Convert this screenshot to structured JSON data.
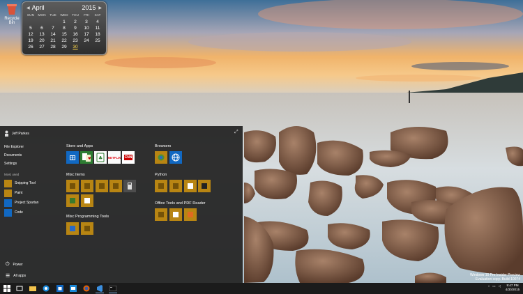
{
  "desktop": {
    "recycle_bin_label": "Recycle Bin",
    "watermark": {
      "line1": "Windows 10 Pro Insider Preview",
      "line2": "Evaluation copy. Build 10074"
    }
  },
  "calendar": {
    "month": "April",
    "year": "2015",
    "days_of_week": [
      "SUN",
      "MON",
      "TUE",
      "WED",
      "THU",
      "FRI",
      "SAT"
    ],
    "weeks": [
      [
        "",
        "",
        "",
        "1",
        "2",
        "3",
        "4"
      ],
      [
        "5",
        "6",
        "7",
        "8",
        "9",
        "10",
        "11"
      ],
      [
        "12",
        "13",
        "14",
        "15",
        "16",
        "17",
        "18"
      ],
      [
        "19",
        "20",
        "21",
        "22",
        "23",
        "24",
        "25"
      ],
      [
        "26",
        "27",
        "28",
        "29",
        "30",
        "",
        ""
      ]
    ],
    "today": "30"
  },
  "start_menu": {
    "user_name": "Jeff Parkes",
    "links": [
      "File Explorer",
      "Documents",
      "Settings"
    ],
    "most_used_label": "Most used",
    "most_used": [
      {
        "label": "Snipping Tool",
        "icon": "scissors-icon",
        "color": "gold"
      },
      {
        "label": "Paint",
        "icon": "paint-icon",
        "color": "gold"
      },
      {
        "label": "Project Spartan",
        "icon": "spartan-icon",
        "color": "blue"
      },
      {
        "label": "Code",
        "icon": "code-icon",
        "color": "blue"
      }
    ],
    "power_label": "Power",
    "all_apps_label": "All apps",
    "groups": [
      {
        "title": "Store and Apps",
        "tiles": [
          "store-tile",
          "solitaire-tile",
          "mahjong-tile",
          "netflix-tile",
          "cnn-tile"
        ],
        "netflix": "NETFLIX",
        "cnn": "CNN"
      },
      {
        "title": "Browsers",
        "tiles": [
          "chrome-tile",
          "ie-tile"
        ]
      },
      {
        "title": "Misc Items",
        "tiles": 9
      },
      {
        "title": "Python",
        "tiles": 4
      },
      {
        "title": "Office Tools and PDF Reader",
        "tiles": 3
      },
      {
        "title": "Misc Programming Tools",
        "tiles": 2
      }
    ]
  },
  "taskbar": {
    "time": "9:47 PM",
    "date": "4/30/2015"
  },
  "colors": {
    "tile_gold": "#b88513",
    "tile_blue": "#1168c2",
    "start_bg": "#282828",
    "taskbar_bg": "#1b1b1b"
  }
}
